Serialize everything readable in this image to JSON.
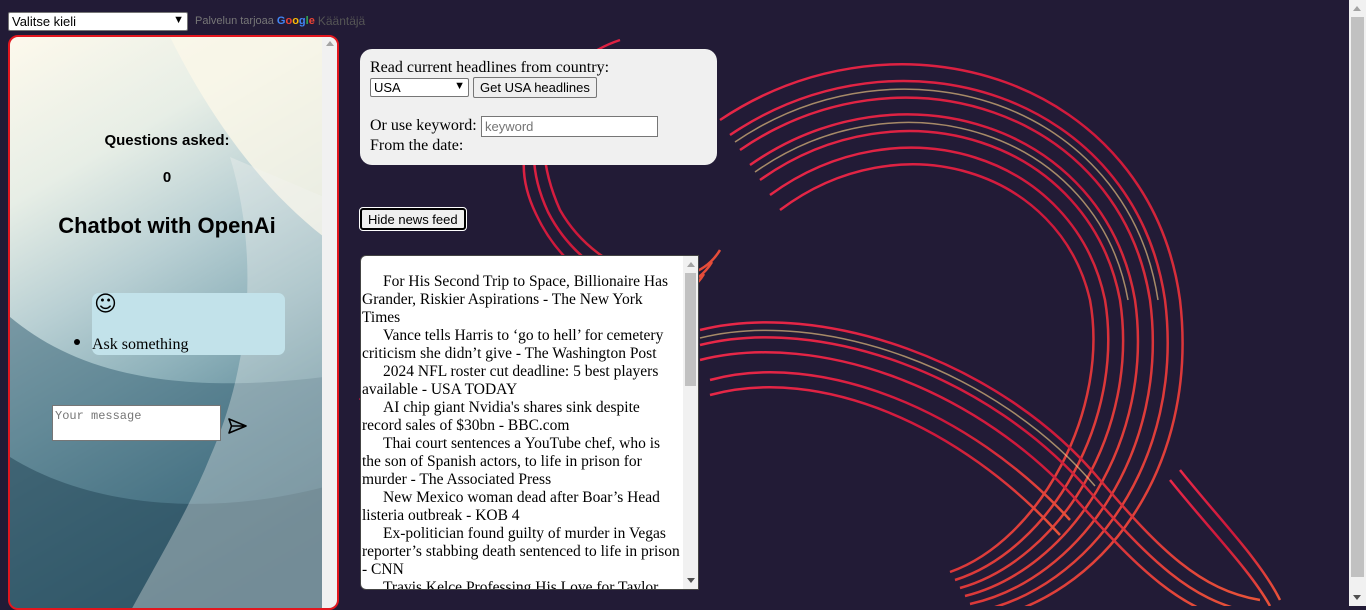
{
  "translate": {
    "select_value": "Valitse kieli",
    "powered_by": "Palvelun tarjoaa",
    "google_letters": [
      "G",
      "o",
      "o",
      "g",
      "l",
      "e"
    ],
    "translate_word": "Kääntäjä"
  },
  "chat": {
    "questions_label": "Questions asked:",
    "questions_count": "0",
    "title": "Chatbot with OpenAi",
    "smiley": "☺",
    "bot_message": "Ask something",
    "input_placeholder": "Your message",
    "send_icon": "send-icon"
  },
  "headlines_form": {
    "country_label": "Read current headlines from country:",
    "country_value": "USA",
    "get_button": "Get USA headlines",
    "keyword_label": "Or use keyword:",
    "keyword_placeholder": "keyword",
    "date_label": "From the date:"
  },
  "hide_button": "Hide news feed",
  "news": [
    "For His Second Trip to Space, Billionaire Has Grander, Riskier Aspirations - The New York Times",
    "Vance tells Harris to ‘go to hell’ for cemetery criticism she didn’t give - The Washington Post",
    "2024 NFL roster cut deadline: 5 best players available - USA TODAY",
    "AI chip giant Nvidia's shares sink despite record sales of $30bn - BBC.com",
    "Thai court sentences a YouTube chef, who is the son of Spanish actors, to life in prison for murder - The Associated Press",
    "New Mexico woman dead after Boar’s Head listeria outbreak - KOB 4",
    "Ex-politician found guilty of murder in Vegas reporter’s stabbing death sentenced to life in prison - CNN",
    "Travis Kelce Professing His Love for Taylor"
  ],
  "colors": {
    "page_bg": "#221b36",
    "panel_border": "#e3161e",
    "bubble": "#c2e2ea",
    "form_bg": "#f0f0f0"
  }
}
